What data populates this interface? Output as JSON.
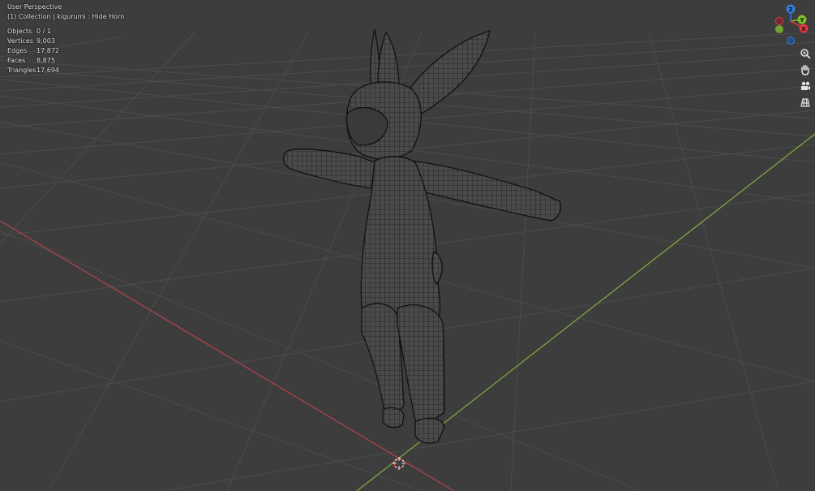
{
  "viewport": {
    "mode": "User Perspective",
    "context": "(1) Collection | kigurumi : Hide Horn"
  },
  "stats": [
    {
      "label": "Objects",
      "value": "0 / 1"
    },
    {
      "label": "Vertices",
      "value": "9,003"
    },
    {
      "label": "Edges",
      "value": "17,872"
    },
    {
      "label": "Faces",
      "value": "8,875"
    },
    {
      "label": "Triangles",
      "value": "17,694"
    }
  ],
  "gizmo": {
    "z": "Z",
    "y": "Y",
    "x": "X"
  },
  "nav_icons": [
    "zoom-icon",
    "pan-hand-icon",
    "camera-view-icon",
    "ortho-grid-icon"
  ],
  "colors": {
    "background": "#3d3d3d",
    "grid": "#4c4c4c",
    "x_axis": "#b8434b",
    "y_axis": "#80b03a",
    "gizmo_x": "#e0393e",
    "gizmo_y": "#7fbf2a",
    "gizmo_z": "#2f7fd8"
  }
}
